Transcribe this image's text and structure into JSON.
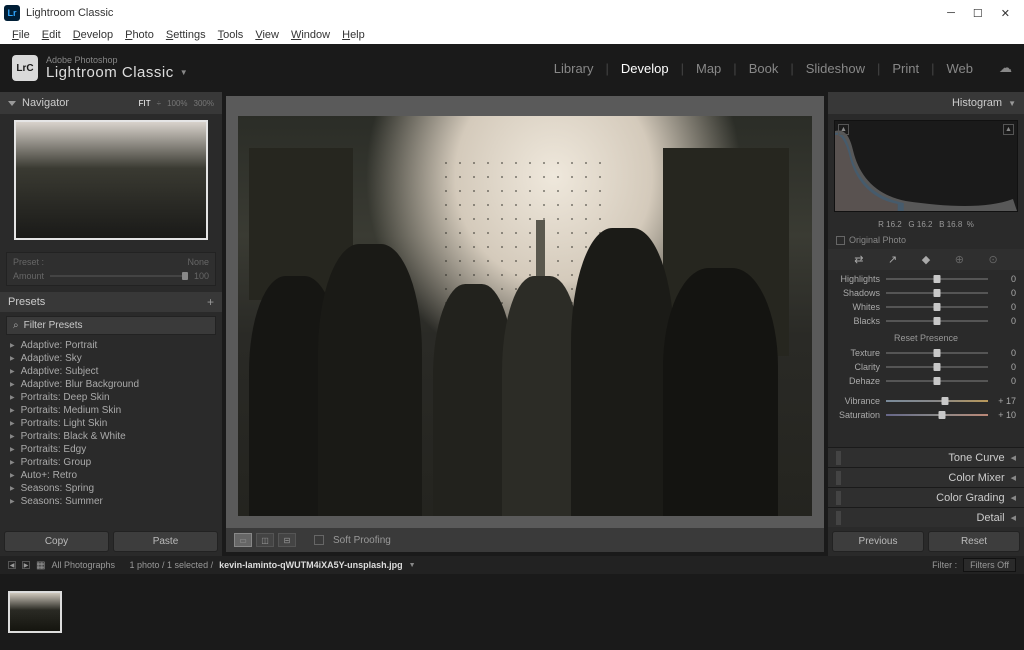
{
  "titlebar": {
    "app": "Lr",
    "title": "Lightroom Classic"
  },
  "menus": [
    "File",
    "Edit",
    "Develop",
    "Photo",
    "Settings",
    "Tools",
    "View",
    "Window",
    "Help"
  ],
  "brand": {
    "top": "Adobe Photoshop",
    "main": "Lightroom Classic"
  },
  "modules": [
    "Library",
    "Develop",
    "Map",
    "Book",
    "Slideshow",
    "Print",
    "Web"
  ],
  "active_module": "Develop",
  "navigator": {
    "title": "Navigator",
    "zoom_modes": {
      "fit": "FIT",
      "fill": "÷",
      "p100": "100%",
      "p300": "300%"
    }
  },
  "amount_box": {
    "preset_lbl": "Preset :",
    "preset_val": "None",
    "amount_lbl": "Amount",
    "amount_val": "100"
  },
  "presets": {
    "title": "Presets",
    "filter_label": "Filter Presets",
    "items": [
      "Adaptive: Portrait",
      "Adaptive: Sky",
      "Adaptive: Subject",
      "Adaptive: Blur Background",
      "Portraits: Deep Skin",
      "Portraits: Medium Skin",
      "Portraits: Light Skin",
      "Portraits: Black & White",
      "Portraits: Edgy",
      "Portraits: Group",
      "Auto+: Retro",
      "Seasons: Spring",
      "Seasons: Summer"
    ]
  },
  "buttons": {
    "copy": "Copy",
    "paste": "Paste",
    "previous": "Previous",
    "reset": "Reset"
  },
  "center_toolbar": {
    "soft_proof": "Soft Proofing"
  },
  "histogram": {
    "title": "Histogram",
    "readout": {
      "r_lbl": "R",
      "r": "16.2",
      "g_lbl": "G",
      "g": "16.2",
      "b_lbl": "B",
      "b": "16.8",
      "pct": "%"
    },
    "orig": "Original Photo"
  },
  "basic": {
    "sliders1": [
      {
        "label": "Highlights",
        "value": "0",
        "pos": 50
      },
      {
        "label": "Shadows",
        "value": "0",
        "pos": 50
      },
      {
        "label": "Whites",
        "value": "0",
        "pos": 50
      },
      {
        "label": "Blacks",
        "value": "0",
        "pos": 50
      }
    ],
    "presence_header": "Reset Presence",
    "sliders2": [
      {
        "label": "Texture",
        "value": "0",
        "pos": 50
      },
      {
        "label": "Clarity",
        "value": "0",
        "pos": 50
      },
      {
        "label": "Dehaze",
        "value": "0",
        "pos": 50
      }
    ],
    "sliders3": [
      {
        "label": "Vibrance",
        "value": "+ 17",
        "pos": 58,
        "cls": "rainbow"
      },
      {
        "label": "Saturation",
        "value": "+ 10",
        "pos": 55,
        "cls": "hue"
      }
    ]
  },
  "collapsed_sections": [
    "Tone Curve",
    "Color Mixer",
    "Color Grading",
    "Detail"
  ],
  "filmstrip": {
    "path_label": "All Photographs",
    "count": "1 photo / 1 selected /",
    "filename": "kevin-laminto-qWUTM4iXA5Y-unsplash.jpg",
    "filter_lbl": "Filter :",
    "filter_val": "Filters Off"
  }
}
